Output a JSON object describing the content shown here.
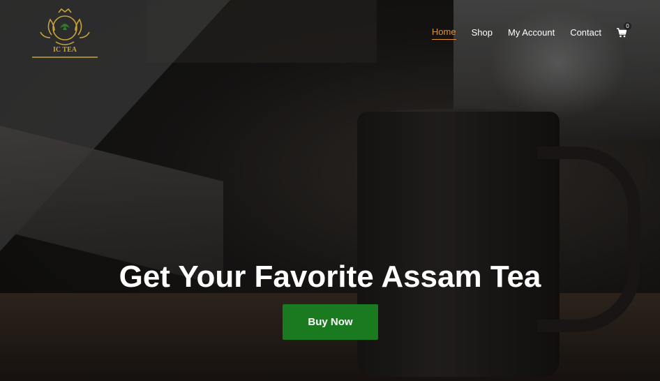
{
  "brand": {
    "logo_text": "IC TEA",
    "logo_icon": "crest-logo-icon"
  },
  "nav": {
    "items": [
      {
        "label": "Home",
        "active": true
      },
      {
        "label": "Shop",
        "active": false
      },
      {
        "label": "My Account",
        "active": false
      },
      {
        "label": "Contact",
        "active": false
      }
    ],
    "cart_icon": "cart-icon",
    "cart_count": "0"
  },
  "hero": {
    "headline": "Get Your Favorite Assam Tea",
    "cta_label": "Buy Now"
  },
  "colors": {
    "accent": "#e8902a",
    "cta": "#1a7a20",
    "logo_gold": "#c9a437"
  }
}
